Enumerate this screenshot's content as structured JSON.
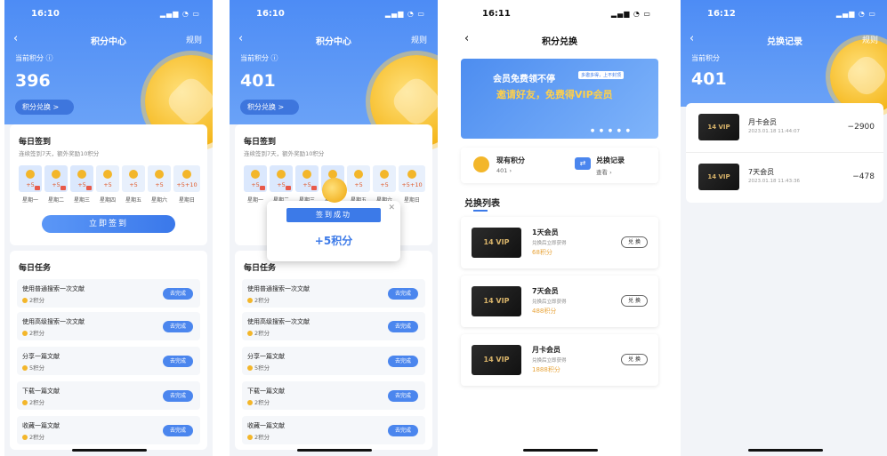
{
  "screens": [
    {
      "status_time": "16:10",
      "nav_title": "积分中心",
      "nav_right": "规则",
      "points_label": "当前积分 ⓘ",
      "points_value": "396",
      "exchange_button": "积分兑换 >",
      "signin_title": "每日签到",
      "signin_sub": "连续签到7天，额外奖励10积分",
      "days": [
        {
          "value": "+5",
          "name": "星期一",
          "done": true
        },
        {
          "value": "+5",
          "name": "星期二",
          "done": true
        },
        {
          "value": "+5",
          "name": "星期三",
          "done": true
        },
        {
          "value": "+5",
          "name": "星期四",
          "done": false
        },
        {
          "value": "+5",
          "name": "星期五",
          "done": false
        },
        {
          "value": "+5",
          "name": "星期六",
          "done": false
        },
        {
          "value": "+5+10",
          "name": "星期日",
          "done": false
        }
      ],
      "signin_button": "立即签到",
      "tasks_title": "每日任务",
      "tasks": [
        {
          "name": "使用普通搜索一次文献",
          "points": "2积分",
          "action": "去完成"
        },
        {
          "name": "使用高级搜索一次文献",
          "points": "2积分",
          "action": "去完成"
        },
        {
          "name": "分享一篇文献",
          "points": "5积分",
          "action": "去完成"
        },
        {
          "name": "下载一篇文献",
          "points": "2积分",
          "action": "去完成"
        },
        {
          "name": "收藏一篇文献",
          "points": "2积分",
          "action": "去完成"
        }
      ]
    },
    {
      "status_time": "16:10",
      "nav_title": "积分中心",
      "nav_right": "规则",
      "points_label": "当前积分 ⓘ",
      "points_value": "401",
      "exchange_button": "积分兑换 >",
      "signin_title": "每日签到",
      "signin_sub": "连续签到7天，额外奖励10积分",
      "days": [
        {
          "value": "+5",
          "name": "星期一",
          "done": true
        },
        {
          "value": "+5",
          "name": "星期二",
          "done": true
        },
        {
          "value": "+5",
          "name": "星期三",
          "done": true
        },
        {
          "value": "+5",
          "name": "星期四",
          "done": true
        },
        {
          "value": "+5",
          "name": "星期五",
          "done": false
        },
        {
          "value": "+5",
          "name": "星期六",
          "done": false
        },
        {
          "value": "+5+10",
          "name": "星期日",
          "done": false
        }
      ],
      "popup_title": "签到成功",
      "popup_value": "+5积分",
      "tasks_title": "每日任务",
      "tasks": [
        {
          "name": "使用普通搜索一次文献",
          "points": "2积分",
          "action": "去完成"
        },
        {
          "name": "使用高级搜索一次文献",
          "points": "2积分",
          "action": "去完成"
        },
        {
          "name": "分享一篇文献",
          "points": "5积分",
          "action": "去完成"
        },
        {
          "name": "下载一篇文献",
          "points": "2积分",
          "action": "去完成"
        },
        {
          "name": "收藏一篇文献",
          "points": "2积分",
          "action": "去完成"
        }
      ]
    },
    {
      "status_time": "16:11",
      "nav_title": "积分兑换",
      "banner_line1": "会员免费领不停",
      "banner_tag": "多邀多得，上不封顶",
      "banner_line2": "邀请好友，免费得VIP会员",
      "current_points_label": "现有积分",
      "current_points_value": "401 ›",
      "history_label": "兑换记录",
      "history_link": "查看 ›",
      "list_title": "兑换列表",
      "products": [
        {
          "name": "1天会员",
          "desc": "兑换后立即获得",
          "cost": "68积分",
          "button": "兑 换"
        },
        {
          "name": "7天会员",
          "desc": "兑换后立即获得",
          "cost": "488积分",
          "button": "兑 换"
        },
        {
          "name": "月卡会员",
          "desc": "兑换后立即获得",
          "cost": "1888积分",
          "button": "兑 换"
        }
      ],
      "vip_label": "14 VIP"
    },
    {
      "status_time": "16:12",
      "nav_title": "兑换记录",
      "nav_right": "规则",
      "points_label": "当前积分",
      "points_value": "401",
      "records": [
        {
          "name": "月卡会员",
          "time": "2023.01.18 11:44:07",
          "amount": "−2900"
        },
        {
          "name": "7天会员",
          "time": "2023.01.18 11:43:36",
          "amount": "−478"
        }
      ],
      "vip_label": "14 VIP"
    }
  ]
}
